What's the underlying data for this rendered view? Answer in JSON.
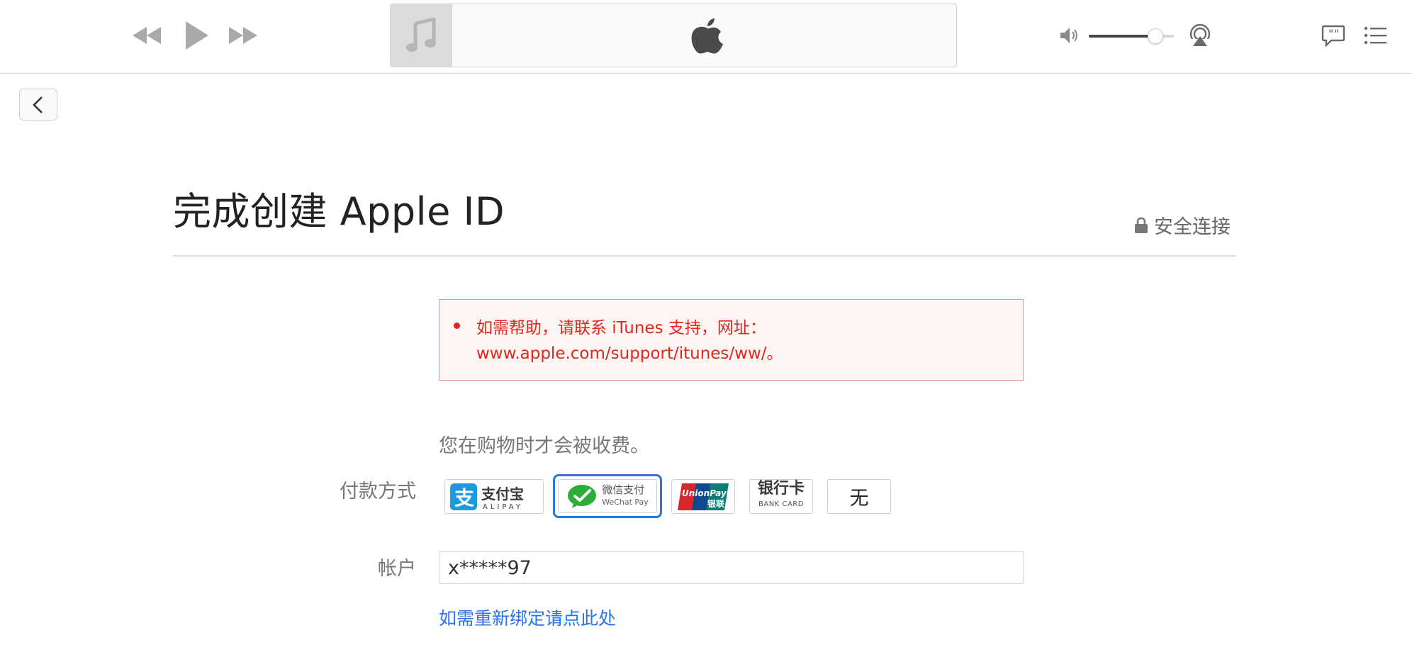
{
  "toolbar": {
    "rewind_icon": "rewind-icon",
    "play_icon": "play-icon",
    "fast_forward_icon": "fast-forward-icon",
    "lcd_placeholder_icon": "music-note-icon",
    "lcd_logo_icon": "apple-logo-icon",
    "volume_icon": "speaker-icon",
    "volume_level": 0.78,
    "airplay_icon": "airplay-icon",
    "lyrics_icon": "lyrics-bubble-icon",
    "up_next_icon": "list-icon"
  },
  "back_button_icon": "chevron-left-icon",
  "page": {
    "title": "完成创建 Apple ID",
    "secure_label": "安全连接",
    "secure_icon": "lock-icon"
  },
  "alert": {
    "line1": "如需帮助，请联系 iTunes 支持，网址：",
    "line2": "www.apple.com/support/itunes/ww/。",
    "color": "#e0281f"
  },
  "form": {
    "note": "您在购物时才会被收费。",
    "payment_label": "付款方式",
    "payment_methods": {
      "alipay": {
        "name_cn": "支付宝",
        "name_en": "ALIPAY"
      },
      "wechat": {
        "name_cn": "微信支付",
        "name_en": "WeChat Pay",
        "selected": true
      },
      "unionpay": {
        "name_en": "UnionPay",
        "name_cn": "银联"
      },
      "bank_card": {
        "name_cn": "银行卡",
        "name_en": "BANK CARD"
      },
      "none": {
        "label": "无"
      }
    },
    "account_label": "帐户",
    "account_value": "x*****97",
    "rebind_link": "如需重新绑定请点此处"
  },
  "colors": {
    "accent": "#2b74e4",
    "error": "#e0281f"
  }
}
